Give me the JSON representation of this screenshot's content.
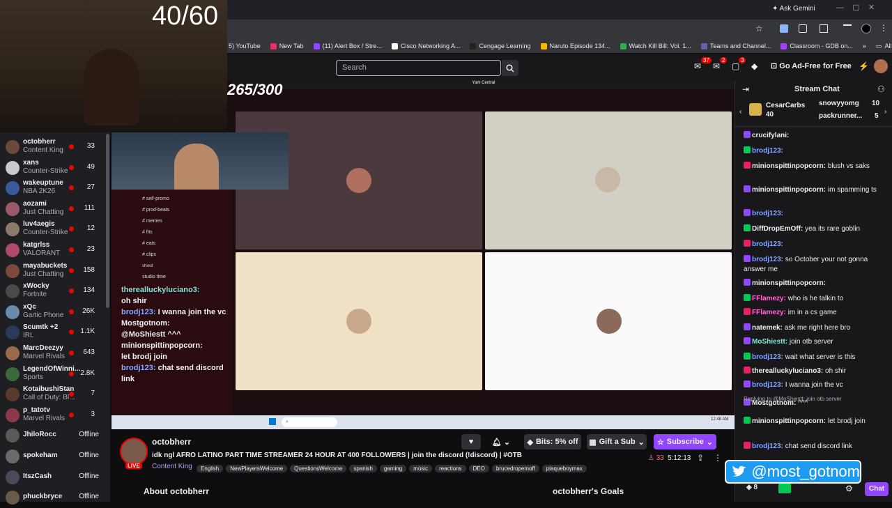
{
  "overlay": {
    "counter": "40/60",
    "score": "265/300",
    "twitter_handle": "@most_gotnom"
  },
  "browser": {
    "gemini": "Ask Gemini",
    "all_bookmarks": "All Bookmarks",
    "bookmarks": [
      "5) YouTube",
      "New Tab",
      "(11) Alert Box / Stre...",
      "Cisco Networking A...",
      "Cengage Learning",
      "Naruto Episode 134...",
      "Watch Kill Bill: Vol. 1...",
      "Teams and Channel...",
      "Classroom - GDB on..."
    ]
  },
  "twitch": {
    "search_placeholder": "Search",
    "notif_counts": [
      "37",
      "2",
      "3"
    ],
    "ad_free": "Go Ad-Free for Free"
  },
  "sidebar": {
    "items": [
      {
        "name": "octobherr",
        "game": "Content King",
        "viewers": "33",
        "live": true,
        "color": "#6a4a3a"
      },
      {
        "name": "xans",
        "game": "Counter-Strike",
        "viewers": "49",
        "live": true,
        "color": "#c9c9d0"
      },
      {
        "name": "wakeuptune",
        "game": "NBA 2K26",
        "viewers": "27",
        "live": true,
        "color": "#3a5a9a"
      },
      {
        "name": "aozami",
        "game": "Just Chatting",
        "viewers": "111",
        "live": true,
        "color": "#9a5a6a"
      },
      {
        "name": "luv4aegis",
        "game": "Counter-Strike",
        "viewers": "12",
        "live": true,
        "color": "#8a7a6a"
      },
      {
        "name": "katgrlss",
        "game": "VALORANT",
        "viewers": "23",
        "live": true,
        "color": "#b04a6a"
      },
      {
        "name": "mayabuckets",
        "game": "Just Chatting",
        "viewers": "158",
        "live": true,
        "color": "#7a4a3a"
      },
      {
        "name": "xWocky",
        "game": "Fortnite",
        "viewers": "134",
        "live": true,
        "color": "#4a4a4a"
      },
      {
        "name": "xQc",
        "game": "Gartic Phone",
        "viewers": "26K",
        "live": true,
        "color": "#6a8aaa"
      },
      {
        "name": "Scumtk +2",
        "game": "IRL",
        "viewers": "1.1K",
        "live": true,
        "color": "#2a3a5a"
      },
      {
        "name": "MarcDeezyy",
        "game": "Marvel Rivals",
        "viewers": "643",
        "live": true,
        "color": "#9a6a4a"
      },
      {
        "name": "LegendOfWinni...",
        "game": "Sports",
        "viewers": "2.8K",
        "live": true,
        "color": "#3a6a3a"
      },
      {
        "name": "KotaibushiStan",
        "game": "Call of Duty: Bl...",
        "viewers": "7",
        "live": true,
        "color": "#5a3a2a"
      },
      {
        "name": "p_tatotv",
        "game": "Marvel Rivals",
        "viewers": "3",
        "live": true,
        "color": "#8a3a4a"
      },
      {
        "name": "JhiloRocc",
        "game": "",
        "viewers": "Offline",
        "live": false,
        "color": "#5a5a5a"
      },
      {
        "name": "spokeham",
        "game": "",
        "viewers": "Offline",
        "live": false,
        "color": "#6a6a6a"
      },
      {
        "name": "ItszCash",
        "game": "",
        "viewers": "Offline",
        "live": false,
        "color": "#4a4a5a"
      },
      {
        "name": "phuckbryce",
        "game": "",
        "viewers": "Offline",
        "live": false,
        "color": "#6a5a4a"
      }
    ]
  },
  "discord": {
    "channels": [
      "self-promo",
      "prod-beats",
      "memes",
      "fits",
      "eats",
      "clips"
    ],
    "category": "shiest",
    "voice": "studio time",
    "overlay_chat": [
      {
        "user": "therealluckyluciano3:",
        "text": "oh shir"
      },
      {
        "user": "brodj123:",
        "text": "I wanna join the vc"
      },
      {
        "user": "Mostgotnom:",
        "text": "@MoShiestt ^^^"
      },
      {
        "user": "minionspittinpopcorn:",
        "text": "let brodj join"
      },
      {
        "user": "brodj123:",
        "text": "chat send discord link"
      }
    ]
  },
  "stream_window": {
    "title": "Yam Central"
  },
  "channel": {
    "name": "octobherr",
    "title": "idk ngl AFRO LATINO PART TIME STREAMER 24 HOUR AT 400 FOLLOWERS | join the discord (!discord) | #OTB",
    "category": "Content King",
    "live": "LIVE",
    "viewers": "33",
    "uptime": "5:12:13",
    "tags": [
      "English",
      "NewPlayersWelcome",
      "QuestionsWelcome",
      "spanish",
      "gaming",
      "músic",
      "reactions",
      "DEO",
      "brucedropemoff",
      "plaqueboymax"
    ],
    "bits": "Bits: 5% off",
    "gift": "Gift a Sub",
    "subscribe": "Subscribe",
    "about": "About octobherr",
    "goals": "octobherr's Goals"
  },
  "chat": {
    "header": "Stream Chat",
    "leader": [
      {
        "name": "CesarCarbs",
        "count": "40"
      },
      {
        "name": "snowyyomg",
        "count": "10"
      },
      {
        "name": "packrunner...",
        "count": "5"
      }
    ],
    "messages": [
      {
        "user": "crucifylani:",
        "text": "",
        "cls": "u-white"
      },
      {
        "user": "brodj123:",
        "text": "",
        "cls": "u-blue"
      },
      {
        "user": "minionspittinpopcorn:",
        "text": "blush vs saks",
        "cls": "u-white"
      },
      {
        "user": "minionspittinpopcorn:",
        "text": "im spamming ts",
        "cls": "u-white"
      },
      {
        "user": "brodj123:",
        "text": "",
        "cls": "u-blue"
      },
      {
        "user": "DiffDropEmOff:",
        "text": "yea its rare goblin",
        "cls": "u-white"
      },
      {
        "user": "brodj123:",
        "text": "",
        "cls": "u-blue"
      },
      {
        "user": "brodj123:",
        "text": "so October your not gonna answer me",
        "cls": "u-blue"
      },
      {
        "user": "minionspittinpopcorn:",
        "text": "",
        "cls": "u-white"
      },
      {
        "user": "FFlamezy:",
        "text": "who is he talkin to",
        "cls": "u-pink"
      },
      {
        "user": "FFlamezy:",
        "text": "im in a cs game",
        "cls": "u-pink"
      },
      {
        "user": "natemek:",
        "text": "ask me right here bro",
        "cls": "u-white"
      },
      {
        "user": "MoShiestt:",
        "text": "join otb server",
        "cls": "u-teal"
      },
      {
        "user": "brodj123:",
        "text": "wait what server is this",
        "cls": "u-blue"
      },
      {
        "user": "therealluckyluciano3:",
        "text": "oh shir",
        "cls": "u-white"
      },
      {
        "user": "brodj123:",
        "text": "I wanna join the vc",
        "cls": "u-blue"
      },
      {
        "user": "Mostgotnom:",
        "text": "^^^",
        "cls": "u-white"
      },
      {
        "user": "minionspittinpopcorn:",
        "text": "let brodj join",
        "cls": "u-white"
      },
      {
        "user": "brodj123:",
        "text": "chat send discord link",
        "cls": "u-blue"
      }
    ],
    "reply": "Replying to @MoShiestt: join otb server",
    "points": "8",
    "chat_button": "Chat"
  }
}
